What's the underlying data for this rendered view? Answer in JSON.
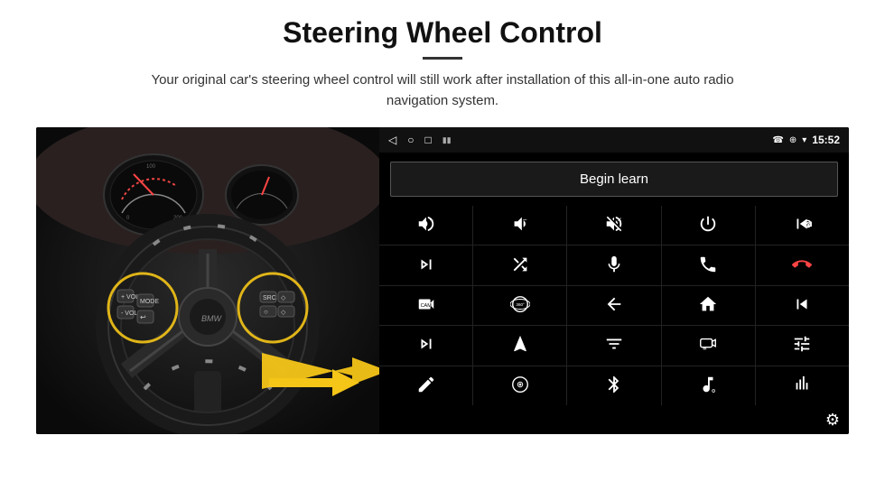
{
  "header": {
    "title": "Steering Wheel Control",
    "subtitle": "Your original car's steering wheel control will still work after installation of this all-in-one auto radio navigation system.",
    "divider": true
  },
  "status_bar": {
    "time": "15:52",
    "nav_icons": [
      "◁",
      "○",
      "□"
    ],
    "right_icons": [
      "☎",
      "⊕",
      "▾",
      "▮▮"
    ]
  },
  "begin_learn": {
    "label": "Begin learn"
  },
  "controls": [
    {
      "id": "vol-up",
      "icon": "vol_up"
    },
    {
      "id": "vol-down",
      "icon": "vol_down"
    },
    {
      "id": "vol-mute",
      "icon": "vol_mute"
    },
    {
      "id": "power",
      "icon": "power"
    },
    {
      "id": "prev-track-phone",
      "icon": "prev_phone"
    },
    {
      "id": "skip-fwd",
      "icon": "skip_fwd"
    },
    {
      "id": "shuffle",
      "icon": "shuffle"
    },
    {
      "id": "mic",
      "icon": "mic"
    },
    {
      "id": "phone",
      "icon": "phone"
    },
    {
      "id": "hang-up",
      "icon": "hang_up"
    },
    {
      "id": "cam",
      "icon": "cam"
    },
    {
      "id": "360",
      "icon": "view360"
    },
    {
      "id": "back",
      "icon": "back"
    },
    {
      "id": "home",
      "icon": "home"
    },
    {
      "id": "prev-chapter",
      "icon": "prev_chapter"
    },
    {
      "id": "next-chapter",
      "icon": "next_chapter"
    },
    {
      "id": "navigate",
      "icon": "navigate"
    },
    {
      "id": "eq",
      "icon": "eq"
    },
    {
      "id": "dash-cam",
      "icon": "dash_cam"
    },
    {
      "id": "equalizer",
      "icon": "equalizer"
    },
    {
      "id": "edit",
      "icon": "edit"
    },
    {
      "id": "dvd",
      "icon": "dvd"
    },
    {
      "id": "bluetooth",
      "icon": "bluetooth"
    },
    {
      "id": "music",
      "icon": "music"
    },
    {
      "id": "spectrum",
      "icon": "spectrum"
    }
  ],
  "gear_label": "⚙"
}
